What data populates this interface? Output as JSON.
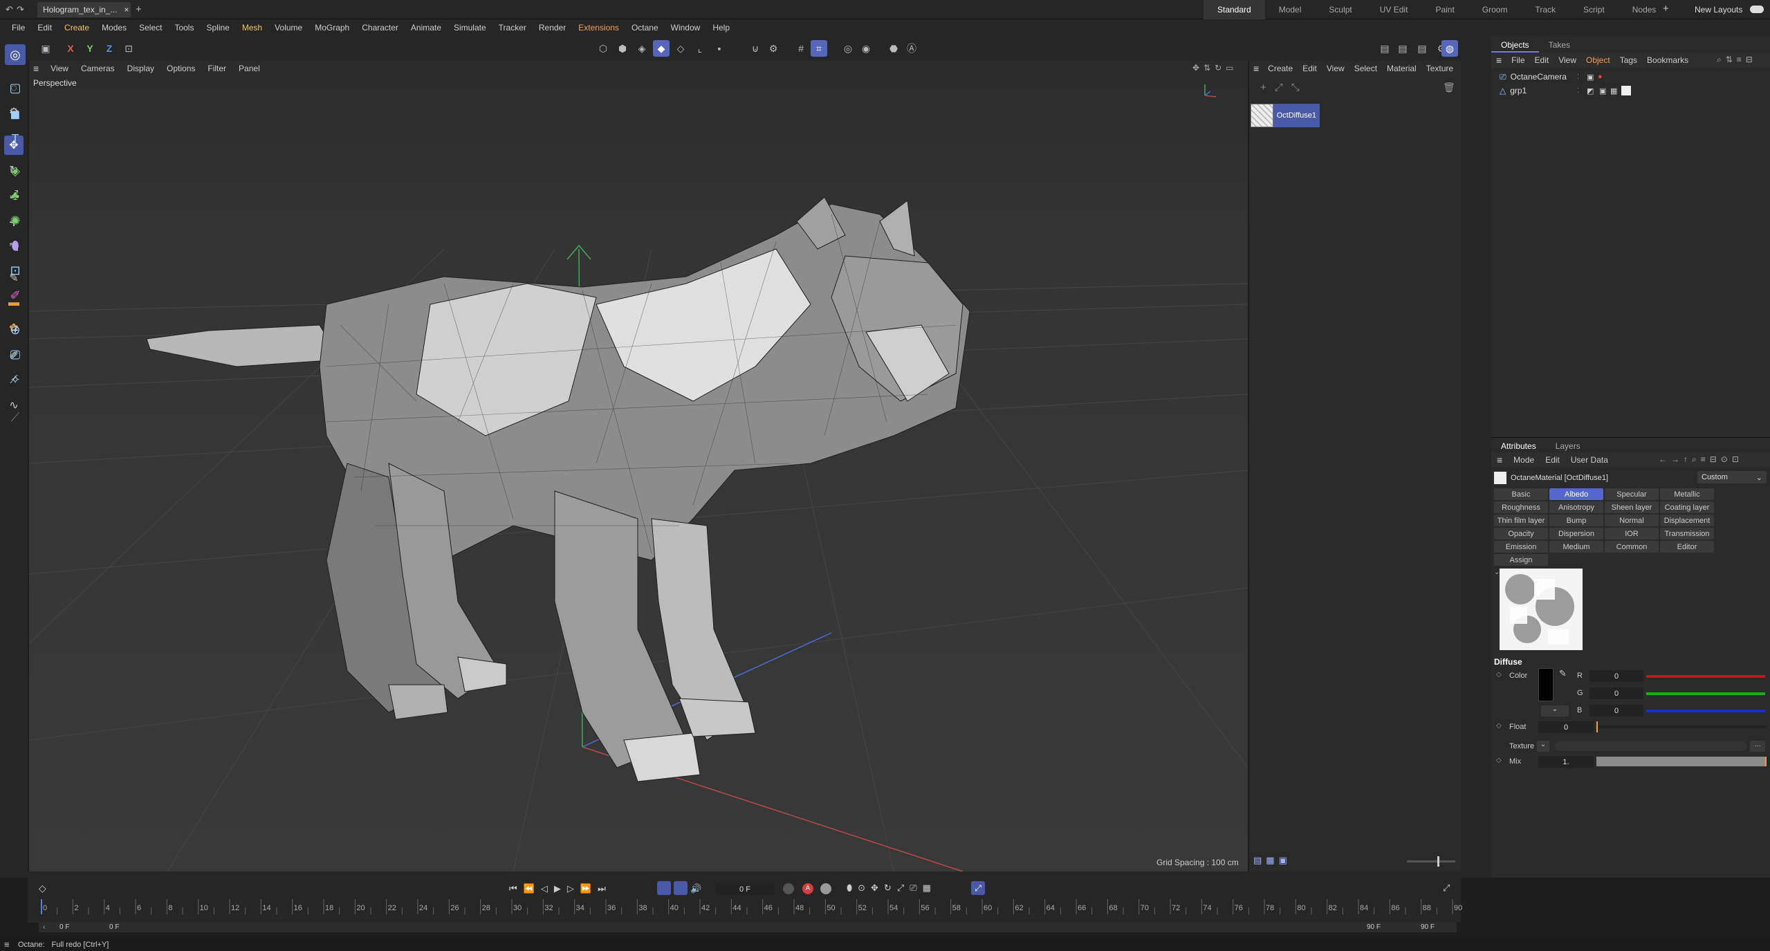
{
  "titlebar": {
    "doc_title": "Hologram_tex_in_..."
  },
  "layouts": [
    "Standard",
    "Model",
    "Sculpt",
    "UV Edit",
    "Paint",
    "Groom",
    "Track",
    "Script",
    "Nodes"
  ],
  "layouts_extra": "New Layouts",
  "menubar": [
    "File",
    "Edit",
    "Create",
    "Modes",
    "Select",
    "Tools",
    "Spline",
    "Mesh",
    "Volume",
    "MoGraph",
    "Character",
    "Animate",
    "Simulate",
    "Tracker",
    "Render",
    "Extensions",
    "Octane",
    "Window",
    "Help"
  ],
  "axes": [
    "X",
    "Y",
    "Z"
  ],
  "viewport": {
    "menu": [
      "View",
      "Cameras",
      "Display",
      "Options",
      "Filter",
      "Panel"
    ],
    "label": "Perspective",
    "grid_spacing": "Grid Spacing : 100 cm"
  },
  "material_manager": {
    "menu": [
      "Create",
      "Edit",
      "View",
      "Select",
      "Material",
      "Texture"
    ],
    "material_name": "OctDiffuse1"
  },
  "object_manager": {
    "tabs": [
      "Objects",
      "Takes"
    ],
    "menu": [
      "File",
      "Edit",
      "View",
      "Object",
      "Tags",
      "Bookmarks"
    ],
    "items": [
      "OctaneCamera",
      "grp1"
    ]
  },
  "attributes": {
    "tabs": [
      "Attributes",
      "Layers"
    ],
    "menu": [
      "Mode",
      "Edit",
      "User Data"
    ],
    "object_title": "OctaneMaterial [OctDiffuse1]",
    "preset": "Custom",
    "channel_buttons": [
      "Basic",
      "Albedo",
      "Specular",
      "Metallic",
      "Roughness",
      "Anisotropy",
      "Sheen layer",
      "Coating layer",
      "Thin film layer",
      "Bump",
      "Normal",
      "Displacement",
      "Opacity",
      "Dispersion",
      "IOR",
      "Transmission",
      "Emission",
      "Medium",
      "Common",
      "Editor",
      "Assign"
    ],
    "active_channel": "Albedo",
    "section": "Diffuse",
    "color_label": "Color",
    "rgb_labels": [
      "R",
      "G",
      "B"
    ],
    "rgb_values": [
      "0",
      "0",
      "0"
    ],
    "float_label": "Float",
    "float_value": "0",
    "texture_label": "Texture",
    "mix_label": "Mix",
    "mix_value": "1."
  },
  "timeline": {
    "current_frame": "0 F",
    "ticks": [
      "0",
      "2",
      "4",
      "6",
      "8",
      "10",
      "12",
      "14",
      "16",
      "18",
      "20",
      "22",
      "24",
      "26",
      "28",
      "30",
      "32",
      "34",
      "36",
      "38",
      "40",
      "42",
      "44",
      "46",
      "48",
      "50",
      "52",
      "54",
      "56",
      "58",
      "60",
      "62",
      "64",
      "66",
      "68",
      "70",
      "72",
      "74",
      "76",
      "78",
      "80",
      "82",
      "84",
      "86",
      "88",
      "90"
    ],
    "start_field": "0 F",
    "start_field2": "0 F",
    "end_field": "90 F",
    "end_field2": "90 F"
  },
  "status": {
    "app": "Octane:",
    "message": "Full redo [Ctrl+Y]"
  }
}
